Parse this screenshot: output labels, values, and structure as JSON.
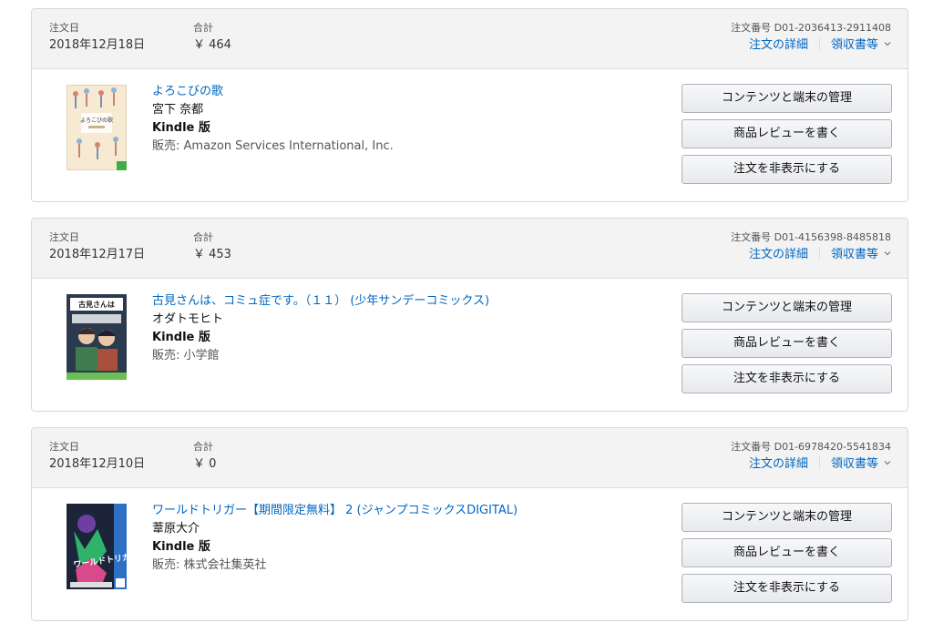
{
  "labels": {
    "order_date": "注文日",
    "total": "合計",
    "order_number_prefix": "注文番号",
    "order_details": "注文の詳細",
    "receipt": "領収書等",
    "manage_content": "コンテンツと端末の管理",
    "write_review": "商品レビューを書く",
    "hide_order": "注文を非表示にする"
  },
  "orders": [
    {
      "date": "2018年12月18日",
      "total": "￥ 464",
      "order_number": "D01-2036413-2911408",
      "title": "よろこびの歌",
      "author": "宮下 奈都",
      "format": "Kindle 版",
      "seller": "販売: Amazon Services International, Inc.",
      "cover_text": "よろこびの歌"
    },
    {
      "date": "2018年12月17日",
      "total": "￥ 453",
      "order_number": "D01-4156398-8485818",
      "title": "古見さんは、コミュ症です。（１１） (少年サンデーコミックス)",
      "author": "オダトモヒト",
      "format": "Kindle 版",
      "seller": "販売: 小学館",
      "cover_text": "古見さんは"
    },
    {
      "date": "2018年12月10日",
      "total": "￥ 0",
      "order_number": "D01-6978420-5541834",
      "title": "ワールドトリガー【期間限定無料】 2 (ジャンプコミックスDIGITAL)",
      "author": "葦原大介",
      "format": "Kindle 版",
      "seller": "販売: 株式会社集英社",
      "cover_text": "ワールドトリガー"
    }
  ],
  "colors": {
    "link": "#0066c0",
    "header_bg": "#f3f3f3",
    "border": "#d5d9d9"
  }
}
